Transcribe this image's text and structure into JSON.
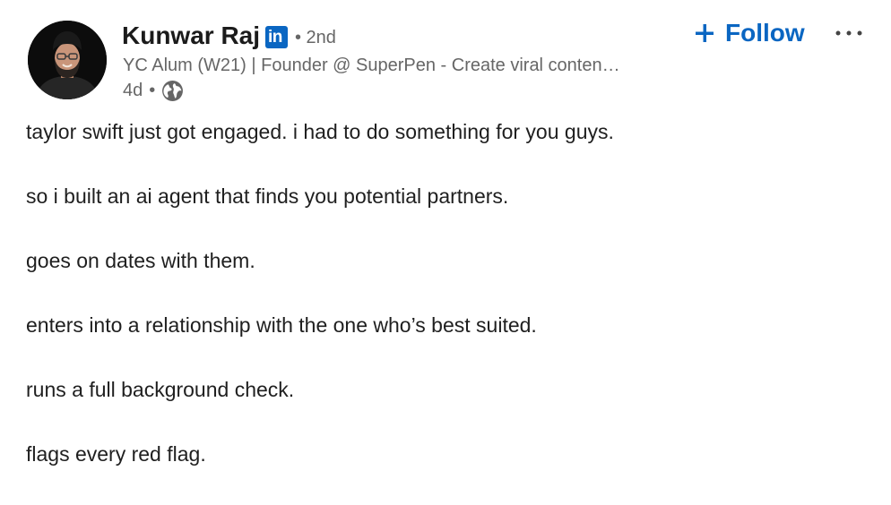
{
  "author": {
    "name": "Kunwar Raj",
    "badge_text": "in",
    "degree": "• 2nd",
    "headline": "YC Alum (W21) | Founder @ SuperPen - Create viral conten…",
    "time": "4d",
    "separator": "•",
    "visibility_icon": "globe-icon",
    "avatar_icon": "avatar-photo"
  },
  "actions": {
    "follow_label": "Follow",
    "follow_icon": "plus-icon",
    "more_icon": "more-horizontal-icon"
  },
  "colors": {
    "brand": "#0a66c2",
    "text_primary": "#1f1f1f",
    "text_secondary": "#666666"
  },
  "post": {
    "lines": [
      "taylor swift just got engaged. i had to do something for you guys.",
      "so i built an ai agent that finds you potential partners.",
      "goes on dates with them.",
      "enters into a relationship with the one who’s best suited.",
      "runs a full background check.",
      "flags every red flag."
    ]
  }
}
